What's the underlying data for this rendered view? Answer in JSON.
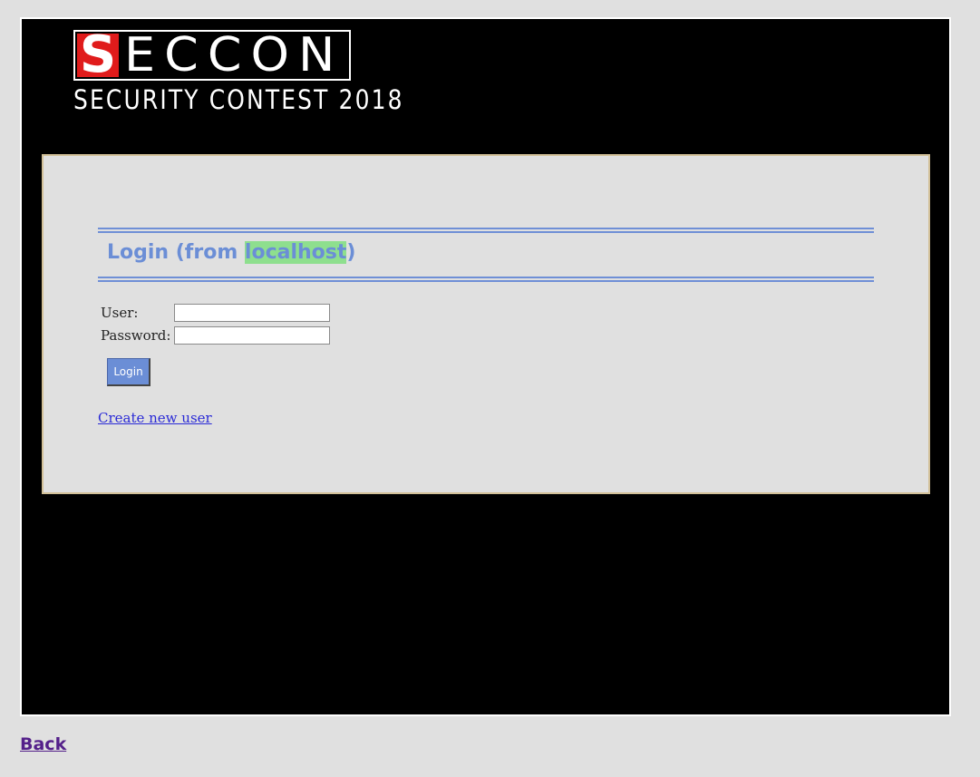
{
  "logo": {
    "letter_s": "S",
    "letters_rest": "ECCON",
    "subtitle": "SECURITY CONTEST 2018",
    "accent_color": "#e01b1b"
  },
  "login": {
    "title_prefix": "Login (from ",
    "host": "localhost",
    "title_suffix": ")",
    "title_color": "#6b8ed6",
    "host_highlight_color": "#8edf8e",
    "user_label": "User:",
    "user_value": "",
    "password_label": "Password:",
    "password_value": "",
    "button_label": "Login",
    "create_user_link": "Create new user"
  },
  "footer": {
    "back_link": "Back"
  }
}
